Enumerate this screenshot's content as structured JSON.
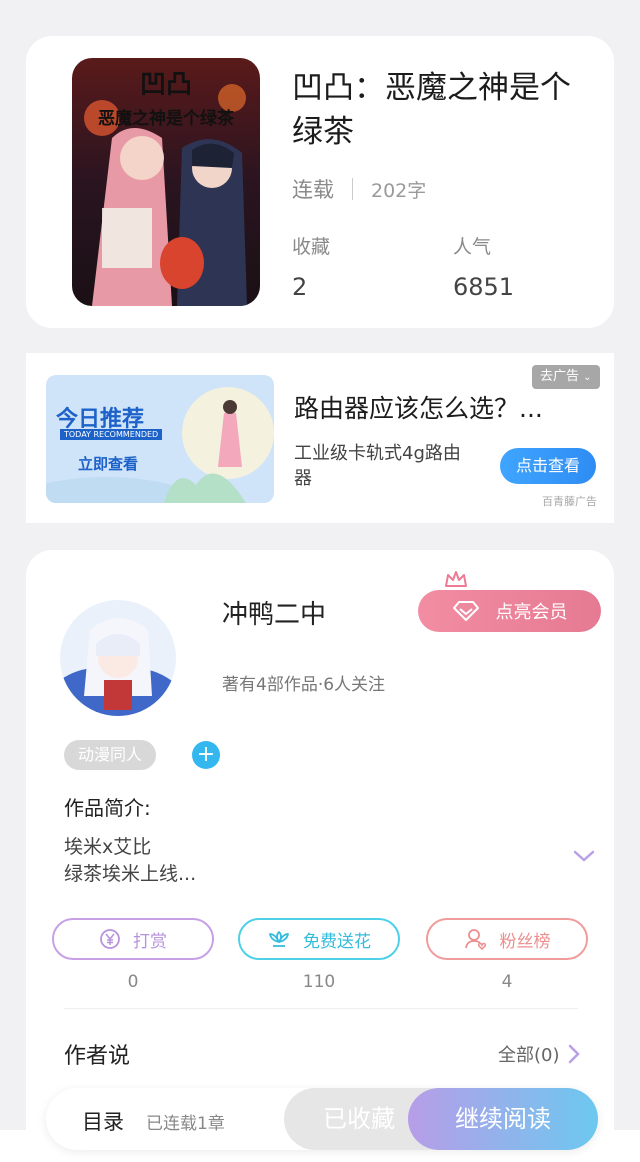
{
  "book": {
    "title": "凹凸：恶魔之神是个绿茶",
    "cover_title_line1": "凹凸",
    "cover_title_line2": "恶魔之神是个绿茶",
    "status": "连载",
    "word_count": "202字",
    "stats": [
      {
        "label": "收藏",
        "value": "2"
      },
      {
        "label": "人气",
        "value": "6851"
      }
    ]
  },
  "ad": {
    "image_title": "今日推荐",
    "image_subtitle": "TODAY RECOMMENDED",
    "image_cta": "立即查看",
    "title": "路由器应该怎么选？...",
    "description": "工业级卡轨式4g路由器",
    "close_label": "去广告",
    "button_label": "点击查看",
    "source": "百青藤广告"
  },
  "author": {
    "name": "冲鸭二中",
    "info": "著有4部作品·6人关注",
    "vip_label": "点亮会员",
    "tag": "动漫同人",
    "intro_title": "作品简介:",
    "intro_text": "埃米x艾比\n绿茶埃米上线..."
  },
  "actions": [
    {
      "label": "打赏",
      "count": "0"
    },
    {
      "label": "免费送花",
      "count": "110"
    },
    {
      "label": "粉丝榜",
      "count": "4"
    }
  ],
  "author_says": {
    "title": "作者说",
    "all_label": "全部(0)"
  },
  "bottom_bar": {
    "toc_label": "目录",
    "toc_sub": "已连载1章",
    "collected_label": "已收藏",
    "continue_label": "继续阅读"
  },
  "colors": {
    "vip": "#e57a93",
    "tip": "#b893dd",
    "flower": "#33bcdc",
    "fans": "#ed8e8e",
    "ad_button": "#2e8cf3"
  }
}
